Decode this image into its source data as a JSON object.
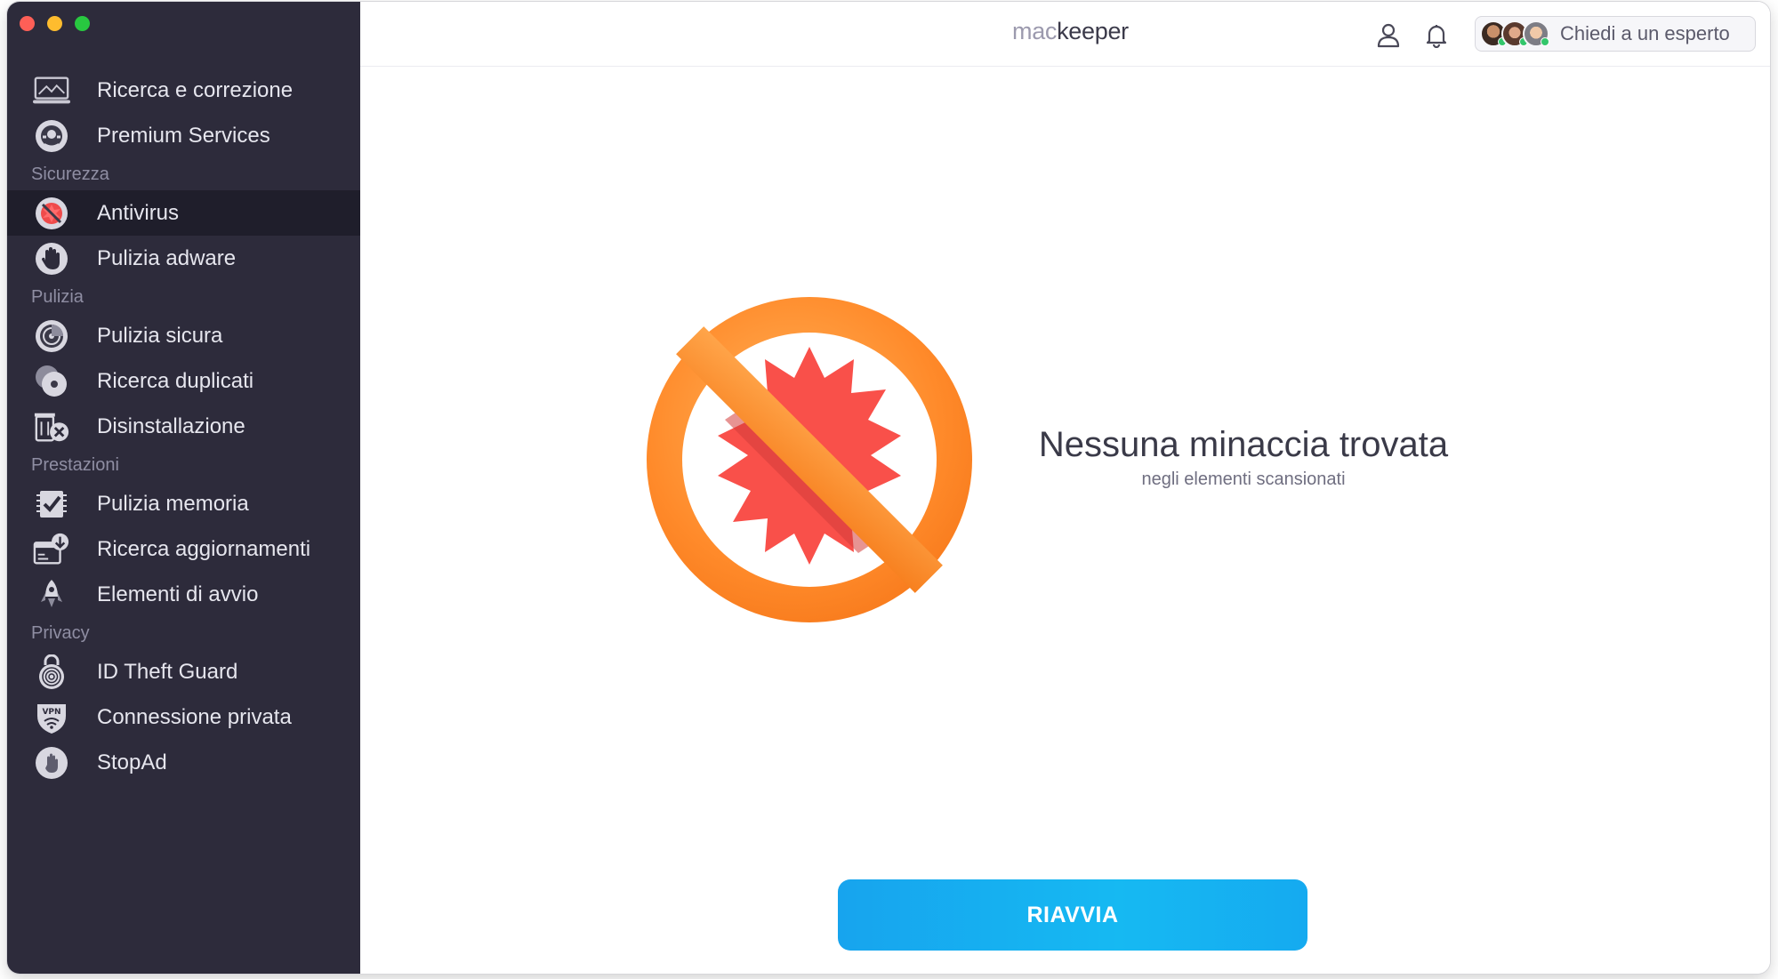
{
  "window_controls": {
    "close_color": "#fe5f57",
    "minimize_color": "#febc2e",
    "maximize_color": "#28c840"
  },
  "sidebar": {
    "groups": [
      {
        "title": "",
        "items": [
          {
            "label": "Ricerca e correzione",
            "icon": "laptop-scan-icon"
          },
          {
            "label": "Premium Services",
            "icon": "premium-services-icon"
          }
        ]
      },
      {
        "title": "Sicurezza",
        "items": [
          {
            "label": "Antivirus",
            "icon": "antivirus-icon",
            "active": true
          },
          {
            "label": "Pulizia adware",
            "icon": "hand-stop-icon"
          }
        ]
      },
      {
        "title": "Pulizia",
        "items": [
          {
            "label": "Pulizia sicura",
            "icon": "disk-clean-icon"
          },
          {
            "label": "Ricerca duplicati",
            "icon": "duplicates-icon"
          },
          {
            "label": "Disinstallazione",
            "icon": "uninstall-icon"
          }
        ]
      },
      {
        "title": "Prestazioni",
        "items": [
          {
            "label": "Pulizia memoria",
            "icon": "memory-chip-icon"
          },
          {
            "label": "Ricerca aggiornamenti",
            "icon": "update-download-icon"
          },
          {
            "label": "Elementi di avvio",
            "icon": "rocket-icon"
          }
        ]
      },
      {
        "title": "Privacy",
        "items": [
          {
            "label": "ID Theft Guard",
            "icon": "fingerprint-lock-icon"
          },
          {
            "label": "Connessione privata",
            "icon": "vpn-shield-icon"
          },
          {
            "label": "StopAd",
            "icon": "stopad-hand-icon"
          }
        ]
      }
    ]
  },
  "header": {
    "logo_mac": "mac",
    "logo_keeper": "keeper",
    "account_icon": "user-icon",
    "notifications_icon": "bell-icon",
    "expert_button_label": "Chiedi a un esperto"
  },
  "main": {
    "illustration_icon": "no-threats-icon",
    "status_title": "Nessuna minaccia trovata",
    "status_subtitle": "negli elementi scansionati",
    "primary_button_label": "RIAVVIA"
  },
  "colors": {
    "sidebar_bg": "#2d2b3b",
    "accent_blue": "#17a4ee",
    "ban_orange": "#ff8a2a",
    "badge_red": "#f9504a"
  }
}
